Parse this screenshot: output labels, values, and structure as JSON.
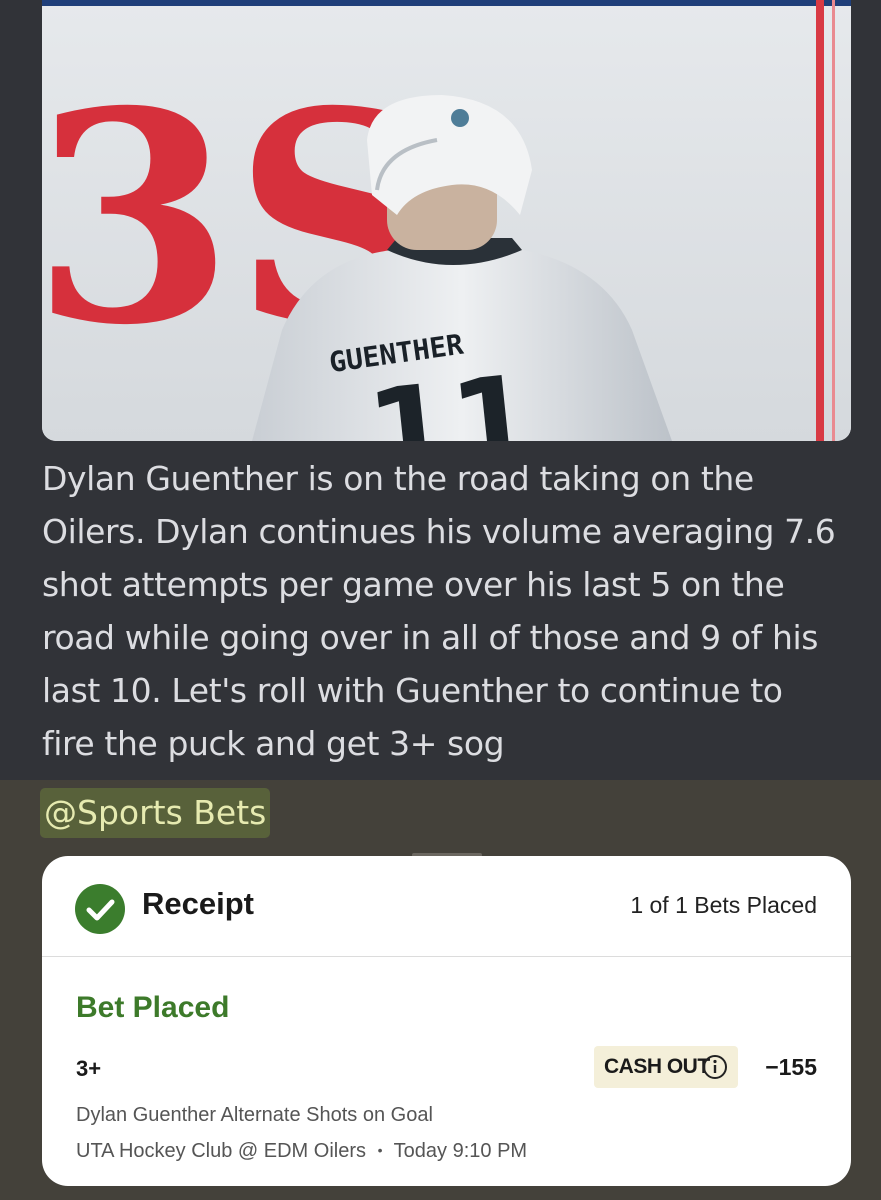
{
  "message": {
    "text": "Dylan Guenther is on the road taking on the Oilers. Dylan continues his volume averaging 7.6 shot attempts per game over his last 5 on the road while going over in all of those and 9 of his last 10. Let's roll with Guenther to continue to fire the puck and get 3+ sog",
    "mention": "@Sports Bets"
  },
  "image": {
    "board_text": "3S",
    "jersey_name": "GUENTHER",
    "jersey_number": "11"
  },
  "receipt": {
    "title": "Receipt",
    "bets_count": "1 of 1 Bets Placed",
    "status": "Bet Placed",
    "selection": "3+",
    "cashout_label": "CASH OUT",
    "odds": "−155",
    "market": "Dylan Guenther Alternate Shots on Goal",
    "matchup": "UTA Hockey Club @ EDM Oilers",
    "separator": "•",
    "time": "Today 9:10 PM",
    "icons": {
      "status": "check-circle-icon",
      "cashout_info": "info-icon"
    }
  },
  "colors": {
    "accent_green": "#3d7a2a",
    "cashout_bg": "#f4efd9",
    "mention_bg": "#58613a"
  }
}
